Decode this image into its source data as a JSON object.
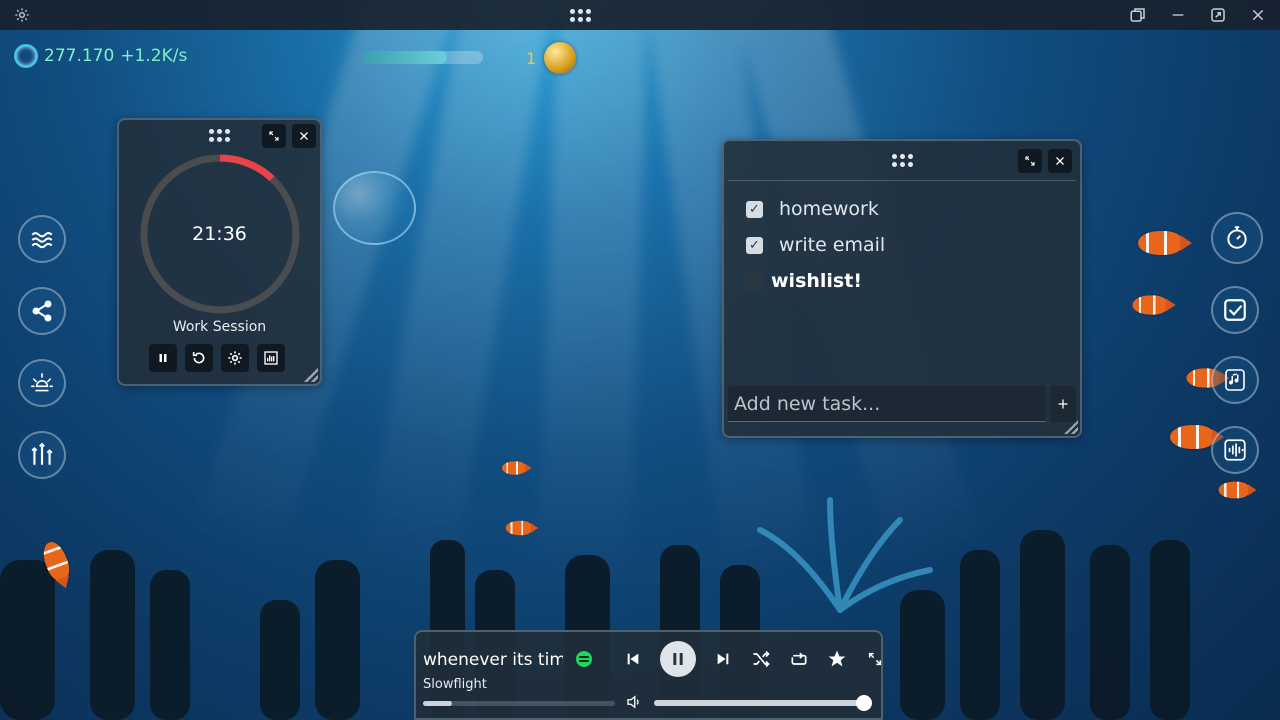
{
  "hud": {
    "bubbles": "277.170",
    "rate": "+1.2K/s",
    "progress": 0.7,
    "coins": "1"
  },
  "timer": {
    "time": "21:36",
    "label": "Work Session",
    "progress": 0.12,
    "ring_color": "#e8424a"
  },
  "tasks": {
    "items": [
      {
        "label": "homework",
        "done": true
      },
      {
        "label": "write email",
        "done": true
      },
      {
        "label": "wishlist!",
        "done": false
      }
    ],
    "input_placeholder": "Add new task..."
  },
  "player": {
    "song": "whenever its time",
    "artist": "Slowflight",
    "seek": 0.15,
    "volume": 0.99
  },
  "icons": {
    "left_rail": [
      "waves-icon",
      "share-icon",
      "sun-icon",
      "sliders-icon"
    ],
    "right_rail": [
      "stopwatch-icon",
      "checklist-icon",
      "music-note-icon",
      "soundwave-icon"
    ]
  },
  "colors": {
    "accent": "#7ff2c8",
    "coin": "#f5c340",
    "spotify": "#1ed760"
  }
}
